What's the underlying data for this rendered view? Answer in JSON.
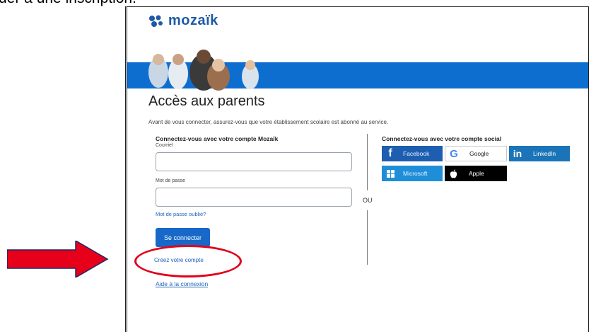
{
  "caption": {
    "text": "der à une inscription."
  },
  "app": {
    "logo_text": "mozaïk"
  },
  "page": {
    "title": "Accès aux parents",
    "intro": "Avant de vous connecter, assurez-vous que votre établissement scolaire est abonné au service."
  },
  "login": {
    "heading": "Connectez-vous avec votre compte Mozaïk",
    "email_label": "Courriel",
    "email_value": "",
    "password_label": "Mot de passe",
    "password_value": "",
    "forgot_link": "Mot de passe oublié?",
    "submit_label": "Se connecter",
    "create_account_link": "Créez votre compte",
    "help_link": "Aide à la connexion"
  },
  "separator": {
    "label": "OU"
  },
  "social": {
    "heading": "Connectez-vous avec votre compte social",
    "buttons": [
      {
        "label": "Facebook",
        "icon": "facebook-icon"
      },
      {
        "label": "Google",
        "icon": "google-icon"
      },
      {
        "label": "LinkedIn",
        "icon": "linkedin-icon"
      },
      {
        "label": "Microsoft",
        "icon": "microsoft-icon"
      },
      {
        "label": "Apple",
        "icon": "apple-icon"
      }
    ]
  },
  "colors": {
    "brand_blue": "#0d6ecf",
    "primary_button": "#1768c9",
    "annotation_red": "#e1001a"
  }
}
